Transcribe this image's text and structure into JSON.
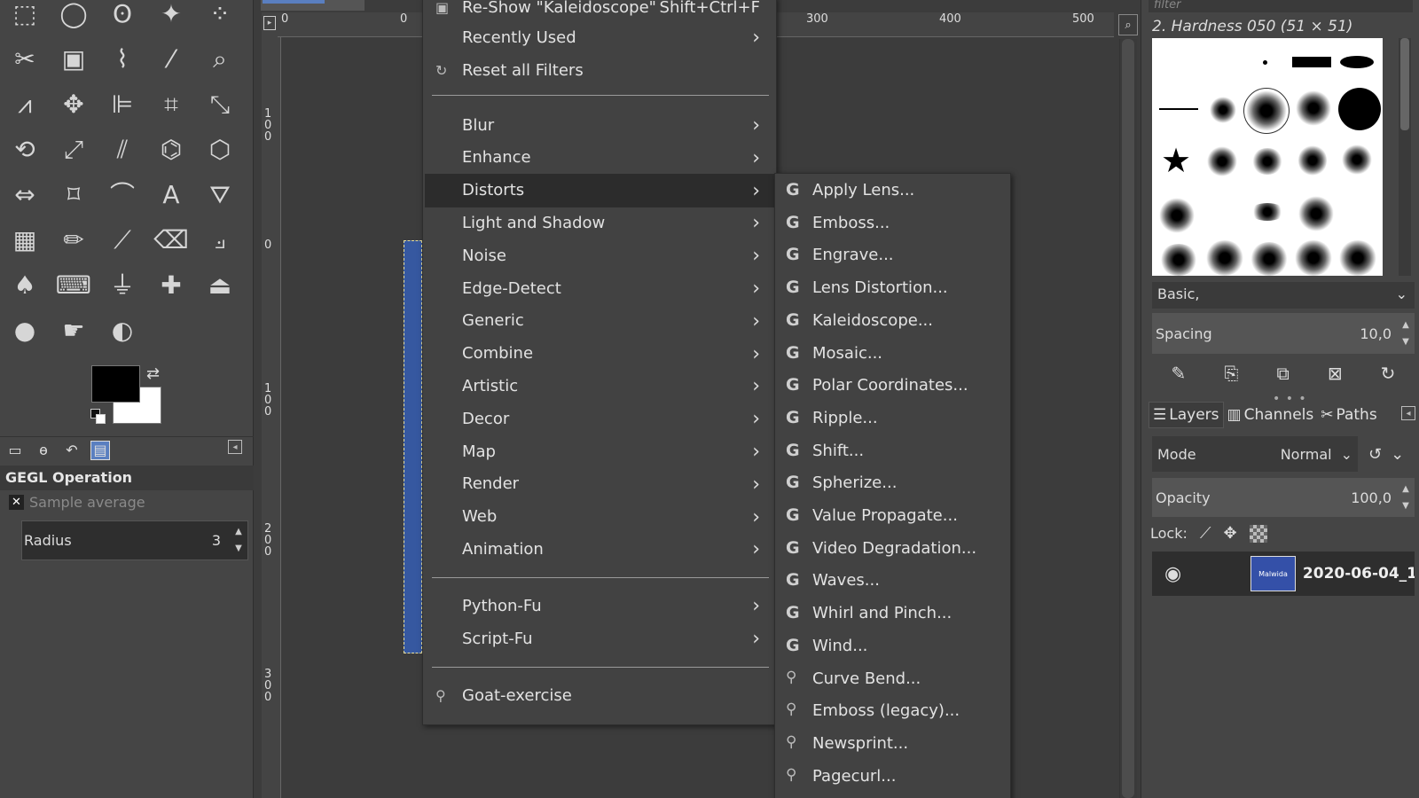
{
  "toolbox": {
    "dock_header": "GEGL Operation",
    "sample_label": "Sample average",
    "radius_label": "Radius",
    "radius_value": "3"
  },
  "rulers": {
    "top_ticks": [
      "0",
      "0",
      "300",
      "400",
      "500"
    ],
    "left_ticks": [
      "1\n0\n0",
      "0",
      "1\n0\n0",
      "2\n0\n0",
      "3\n0\n0"
    ]
  },
  "filters_menu": {
    "top_items": [
      {
        "label": "Re-Show \"Kaleidoscope\"",
        "accel": "Shift+Ctrl+F",
        "icon": "reshow-icon"
      },
      {
        "label": "Recently Used",
        "submenu": true
      },
      {
        "label": "Reset all Filters",
        "icon": "reset-icon"
      }
    ],
    "category_items": [
      {
        "label": "Blur"
      },
      {
        "label": "Enhance"
      },
      {
        "label": "Distorts",
        "active": true
      },
      {
        "label": "Light and Shadow"
      },
      {
        "label": "Noise"
      },
      {
        "label": "Edge-Detect"
      },
      {
        "label": "Generic"
      },
      {
        "label": "Combine"
      },
      {
        "label": "Artistic"
      },
      {
        "label": "Decor"
      },
      {
        "label": "Map"
      },
      {
        "label": "Render"
      },
      {
        "label": "Web"
      },
      {
        "label": "Animation"
      }
    ],
    "script_items": [
      {
        "label": "Python-Fu"
      },
      {
        "label": "Script-Fu"
      }
    ],
    "bottom_item": {
      "label": "Goat-exercise",
      "icon": "script-icon"
    }
  },
  "distorts_menu": {
    "gegl_items": [
      "Apply Lens...",
      "Emboss...",
      "Engrave...",
      "Lens Distortion...",
      "Kaleidoscope...",
      "Mosaic...",
      "Polar Coordinates...",
      "Ripple...",
      "Shift...",
      "Spherize...",
      "Value Propagate...",
      "Video Degradation...",
      "Waves...",
      "Whirl and Pinch...",
      "Wind..."
    ],
    "script_items": [
      "Curve Bend...",
      "Emboss (legacy)...",
      "Newsprint...",
      "Pagecurl..."
    ]
  },
  "brushes": {
    "filter_placeholder": "filter",
    "title": "2. Hardness 050 (51 × 51)",
    "brush_set": "Basic,",
    "spacing_label": "Spacing",
    "spacing_value": "10,0"
  },
  "layers": {
    "tabs": [
      {
        "label": "Layers",
        "icon": "layers-icon"
      },
      {
        "label": "Channels",
        "icon": "channels-icon"
      },
      {
        "label": "Paths",
        "icon": "paths-icon"
      }
    ],
    "mode_label": "Mode",
    "mode_value": "Normal",
    "opacity_label": "Opacity",
    "opacity_value": "100,0",
    "lock_label": "Lock:",
    "layer_name": "2020-06-04_1",
    "thumb_text": "Malwida"
  }
}
